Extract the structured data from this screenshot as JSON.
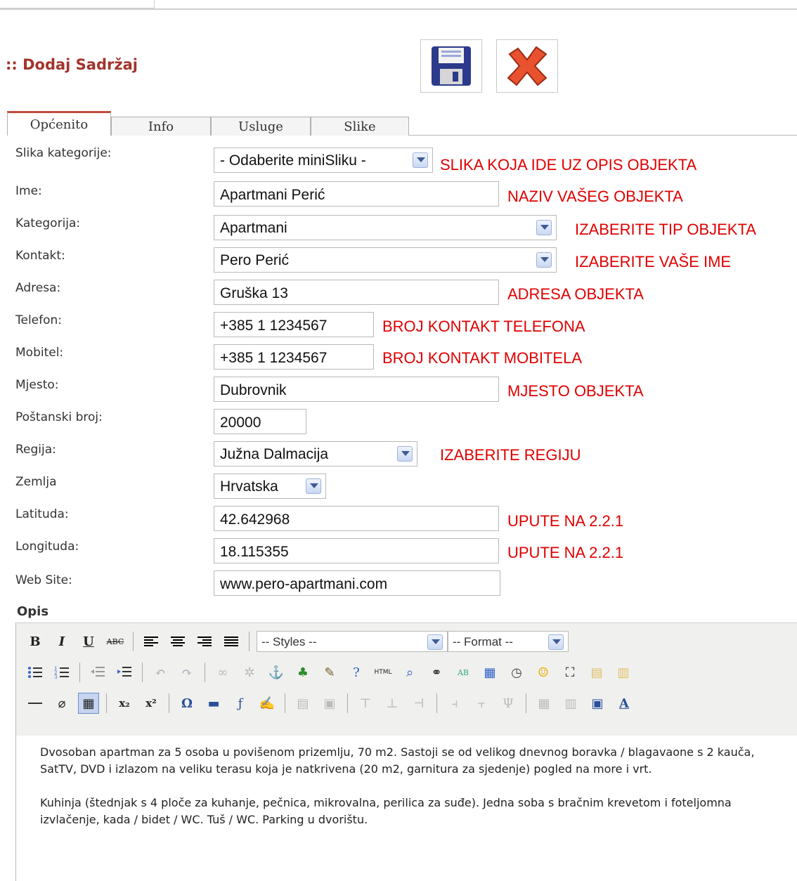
{
  "header": {
    "title": ":: Dodaj Sadržaj"
  },
  "tabs": [
    {
      "label": "Općenito"
    },
    {
      "label": "Info"
    },
    {
      "label": "Usluge"
    },
    {
      "label": "Slike"
    }
  ],
  "form": {
    "slika_kategorije": {
      "label": "Slika kategorije:",
      "value": "- Odaberite miniSliku -",
      "note": "SLIKA KOJA IDE UZ OPIS OBJEKTA"
    },
    "ime": {
      "label": "Ime:",
      "value": "Apartmani Perić",
      "note": "NAZIV VAŠEG OBJEKTA"
    },
    "kategorija": {
      "label": "Kategorija:",
      "value": "Apartmani",
      "note": "IZABERITE TIP OBJEKTA"
    },
    "kontakt": {
      "label": "Kontakt:",
      "value": "Pero Perić",
      "note": "IZABERITE VAŠE IME"
    },
    "adresa": {
      "label": "Adresa:",
      "value": "Gruška 13",
      "note": "ADRESA OBJEKTA"
    },
    "telefon": {
      "label": "Telefon:",
      "value": "+385 1 1234567",
      "note": "BROJ KONTAKT TELEFONA"
    },
    "mobitel": {
      "label": "Mobitel:",
      "value": "+385 1 1234567",
      "note": "BROJ KONTAKT MOBITELA"
    },
    "mjesto": {
      "label": "Mjesto:",
      "value": "Dubrovnik",
      "note": "MJESTO OBJEKTA"
    },
    "postanski_broj": {
      "label": "Poštanski broj:",
      "value": "20000"
    },
    "regija": {
      "label": "Regija:",
      "value": "Južna Dalmacija",
      "note": "IZABERITE REGIJU"
    },
    "zemlja": {
      "label": "Zemlja",
      "value": "Hrvatska"
    },
    "latituda": {
      "label": "Latituda:",
      "value": "42.642968",
      "note": "UPUTE NA 2.2.1"
    },
    "longituda": {
      "label": "Longituda:",
      "value": "18.115355",
      "note": "UPUTE NA 2.2.1"
    },
    "web_site": {
      "label": "Web Site:",
      "value": "www.pero-apartmani.com"
    }
  },
  "editor": {
    "label": "Opis",
    "styles_select": "-- Styles --",
    "format_select": "-- Format --",
    "paragraphs": [
      "Dvosoban apartman za 5 osoba u povišenom prizemlju, 70 m2. Sastoji se od velikog dnevnog boravka / blagavaone s 2 kauča, SatTV, DVD i izlazom na veliku terasu koja je natkrivena (20 m2, garnitura za sjedenje) pogled na more i vrt.",
      "Kuhinja (štednjak s 4 ploče za kuhanje, pečnica, mikrovalna, perilica za suđe). Jedna soba s bračnim krevetom i foteljomna izvlačenje, kada / bidet / WC. Tuš / WC. Parking u dvorištu."
    ]
  },
  "colors": {
    "title": "#a2342c",
    "note": "#e00000",
    "tab_accent": "#c14b3a"
  }
}
